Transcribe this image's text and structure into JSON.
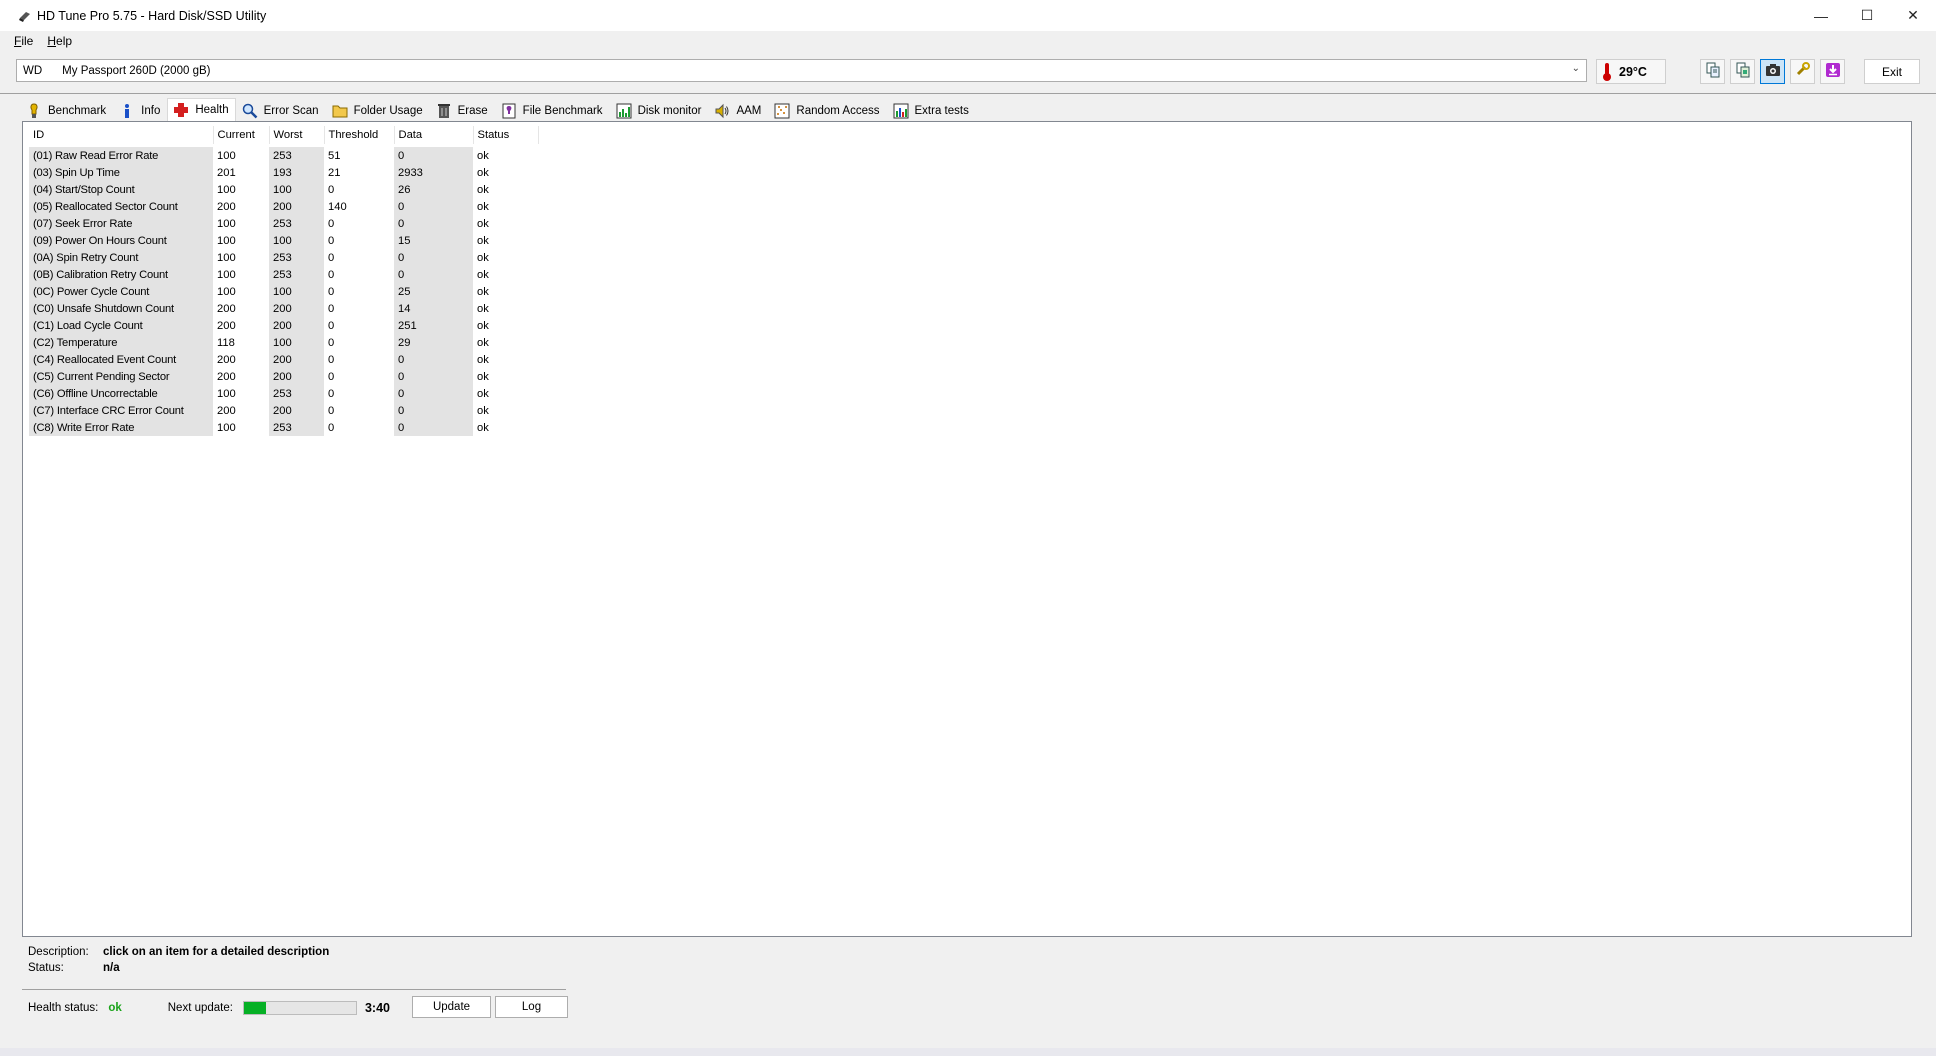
{
  "window": {
    "title": "HD Tune Pro 5.75 - Hard Disk/SSD Utility",
    "controls": [
      "—",
      "☐",
      "✕"
    ]
  },
  "menu": [
    {
      "key": "F",
      "rest": "ile"
    },
    {
      "key": "H",
      "rest": "elp"
    }
  ],
  "drive": {
    "vendor": "WD",
    "model": "My Passport 260D (2000 gB)",
    "temperature": "29°C"
  },
  "toolbar": {
    "exit_label": "Exit",
    "icons": [
      "copy-text-icon",
      "copy-screenshot-icon",
      "camera-icon",
      "options-icon",
      "save-icon"
    ]
  },
  "tabs": [
    {
      "label": "Benchmark",
      "icon": "benchmark-icon",
      "active": false
    },
    {
      "label": "Info",
      "icon": "info-icon",
      "active": false
    },
    {
      "label": "Health",
      "icon": "health-cross-icon",
      "active": true
    },
    {
      "label": "Error Scan",
      "icon": "magnifier-icon",
      "active": false
    },
    {
      "label": "Folder Usage",
      "icon": "folder-icon",
      "active": false
    },
    {
      "label": "Erase",
      "icon": "trash-icon",
      "active": false
    },
    {
      "label": "File Benchmark",
      "icon": "file-benchmark-icon",
      "active": false
    },
    {
      "label": "Disk monitor",
      "icon": "disk-monitor-icon",
      "active": false
    },
    {
      "label": "AAM",
      "icon": "speaker-icon",
      "active": false
    },
    {
      "label": "Random Access",
      "icon": "random-access-icon",
      "active": false
    },
    {
      "label": "Extra tests",
      "icon": "extra-tests-icon",
      "active": false
    }
  ],
  "health_table": {
    "headers": [
      "ID",
      "Current",
      "Worst",
      "Threshold",
      "Data",
      "Status"
    ],
    "rows": [
      [
        "(01) Raw Read Error Rate",
        "100",
        "253",
        "51",
        "0",
        "ok"
      ],
      [
        "(03) Spin Up Time",
        "201",
        "193",
        "21",
        "2933",
        "ok"
      ],
      [
        "(04) Start/Stop Count",
        "100",
        "100",
        "0",
        "26",
        "ok"
      ],
      [
        "(05) Reallocated Sector Count",
        "200",
        "200",
        "140",
        "0",
        "ok"
      ],
      [
        "(07) Seek Error Rate",
        "100",
        "253",
        "0",
        "0",
        "ok"
      ],
      [
        "(09) Power On Hours Count",
        "100",
        "100",
        "0",
        "15",
        "ok"
      ],
      [
        "(0A) Spin Retry Count",
        "100",
        "253",
        "0",
        "0",
        "ok"
      ],
      [
        "(0B) Calibration Retry Count",
        "100",
        "253",
        "0",
        "0",
        "ok"
      ],
      [
        "(0C) Power Cycle Count",
        "100",
        "100",
        "0",
        "25",
        "ok"
      ],
      [
        "(C0) Unsafe Shutdown Count",
        "200",
        "200",
        "0",
        "14",
        "ok"
      ],
      [
        "(C1) Load Cycle Count",
        "200",
        "200",
        "0",
        "251",
        "ok"
      ],
      [
        "(C2) Temperature",
        "118",
        "100",
        "0",
        "29",
        "ok"
      ],
      [
        "(C4) Reallocated Event Count",
        "200",
        "200",
        "0",
        "0",
        "ok"
      ],
      [
        "(C5) Current Pending Sector",
        "200",
        "200",
        "0",
        "0",
        "ok"
      ],
      [
        "(C6) Offline Uncorrectable",
        "100",
        "253",
        "0",
        "0",
        "ok"
      ],
      [
        "(C7) Interface CRC Error Count",
        "200",
        "200",
        "0",
        "0",
        "ok"
      ],
      [
        "(C8) Write Error Rate",
        "100",
        "253",
        "0",
        "0",
        "ok"
      ]
    ]
  },
  "description": {
    "label": "Description:",
    "value": "click on an item for a detailed description",
    "status_label": "Status:",
    "status_value": "n/a"
  },
  "health_status": {
    "label": "Health status:",
    "value": "ok",
    "next_update_label": "Next update:",
    "progress": 0.2,
    "countdown": "3:40",
    "update_button": "Update",
    "log_button": "Log"
  },
  "colors": {
    "ok_green": "#1aa31a",
    "progress_green": "#06b025",
    "health_red": "#d42020"
  }
}
